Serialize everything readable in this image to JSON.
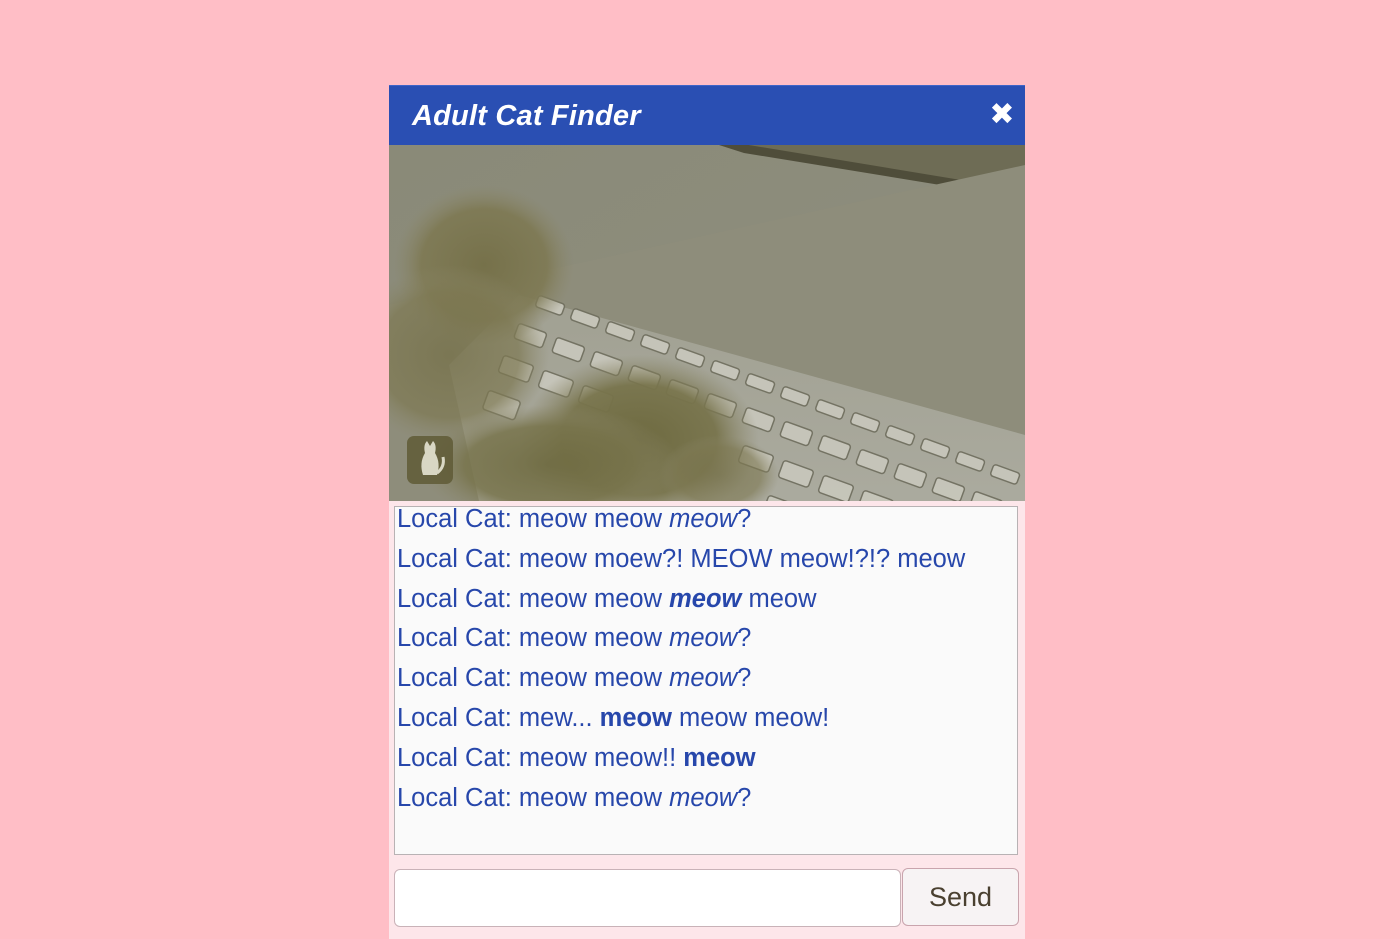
{
  "window": {
    "title": "Adult Cat Finder",
    "close_icon": "close-icon"
  },
  "video": {
    "description_icon": "cat-badge-icon"
  },
  "chat": {
    "messages": [
      {
        "sender": "Local Cat:",
        "parts": [
          {
            "text": " meow meow ",
            "style": "normal"
          },
          {
            "text": "meow",
            "style": "italic"
          },
          {
            "text": "?",
            "style": "normal"
          }
        ]
      },
      {
        "sender": "Local Cat:",
        "parts": [
          {
            "text": " meow moew?! MEOW meow!?!? meow",
            "style": "normal"
          }
        ]
      },
      {
        "sender": "Local Cat:",
        "parts": [
          {
            "text": " meow meow ",
            "style": "normal"
          },
          {
            "text": "meow",
            "style": "bold-italic"
          },
          {
            "text": " meow",
            "style": "normal"
          }
        ]
      },
      {
        "sender": "Local Cat:",
        "parts": [
          {
            "text": " meow meow ",
            "style": "normal"
          },
          {
            "text": "meow",
            "style": "italic"
          },
          {
            "text": "?",
            "style": "normal"
          }
        ]
      },
      {
        "sender": "Local Cat:",
        "parts": [
          {
            "text": " meow meow ",
            "style": "normal"
          },
          {
            "text": "meow",
            "style": "italic"
          },
          {
            "text": "?",
            "style": "normal"
          }
        ]
      },
      {
        "sender": "Local Cat:",
        "parts": [
          {
            "text": " mew... ",
            "style": "normal"
          },
          {
            "text": "meow",
            "style": "bold"
          },
          {
            "text": " meow meow!",
            "style": "normal"
          }
        ]
      },
      {
        "sender": "Local Cat:",
        "parts": [
          {
            "text": " meow meow!! ",
            "style": "normal"
          },
          {
            "text": "meow",
            "style": "bold"
          }
        ]
      },
      {
        "sender": "Local Cat:",
        "parts": [
          {
            "text": " meow meow ",
            "style": "normal"
          },
          {
            "text": "meow",
            "style": "italic"
          },
          {
            "text": "?",
            "style": "normal"
          }
        ]
      }
    ]
  },
  "composer": {
    "input_value": "",
    "input_placeholder": "",
    "send_label": "Send"
  },
  "colors": {
    "page_background": "#ffbec6",
    "titlebar": "#2a4fb3",
    "message_text": "#2747ab"
  }
}
